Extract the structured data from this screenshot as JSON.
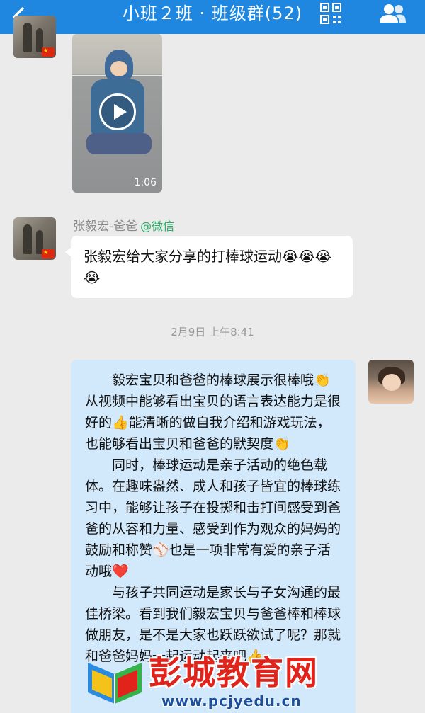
{
  "header": {
    "title": "小班２班 · 班级群(52)",
    "background_color": "#1f87df",
    "icons": [
      "back-arrow-icon",
      "qr-code-icon",
      "group-members-icon"
    ]
  },
  "messages": [
    {
      "type": "video",
      "sender_side": "left",
      "duration": "1:06"
    },
    {
      "type": "text",
      "sender_side": "left",
      "sender_name": "张毅宏-爸爸",
      "sender_source": "@微信",
      "text": "张毅宏给大家分享的打棒球运动😭😭😭😭"
    },
    {
      "type": "timestamp",
      "text": "2月9日 上午8:41"
    },
    {
      "type": "text",
      "sender_side": "right",
      "bubble_color": "#d2e8fb",
      "paragraphs": [
        "毅宏宝贝和爸爸的棒球展示很棒哦👏从视频中能够看出宝贝的语言表达能力是很好的👍能清晰的做自我介绍和游戏玩法，也能够看出宝贝和爸爸的默契度👏",
        "同时，棒球运动是亲子活动的绝色载体。在趣味盎然、成人和孩子皆宜的棒球练习中，能够让孩子在投掷和击打间感受到爸爸的从容和力量、感受到作为观众的妈妈的鼓励和称赞⚾也是一项非常有爱的亲子活动哦❤️",
        "与孩子共同运动是家长与子女沟通的最佳桥梁。看到我们毅宏宝贝与爸爸棒和棒球做朋友，是不是大家也跃跃欲试了呢？那就和爸爸妈妈一起运动起来吧👍"
      ]
    }
  ],
  "watermark": {
    "brand": "彭城教育网",
    "url": "www.pcjyedu.cn"
  }
}
